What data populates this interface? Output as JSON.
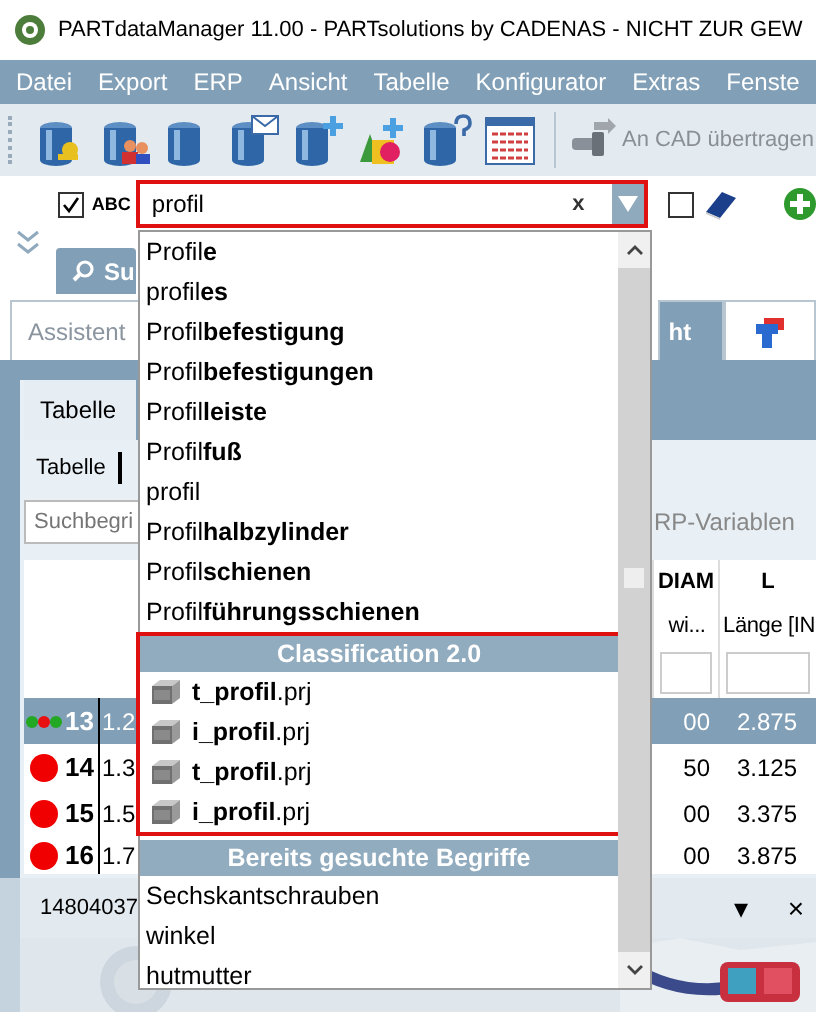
{
  "window": {
    "title": "PARTdataManager 11.00 - PARTsolutions by CADENAS - NICHT ZUR GEW"
  },
  "menu": [
    "Datei",
    "Export",
    "ERP",
    "Ansicht",
    "Tabelle",
    "Konfigurator",
    "Extras",
    "Fenste"
  ],
  "toolbar": {
    "cad_button": "An CAD übertragen"
  },
  "search": {
    "abc_checked": true,
    "abc_label": "ABC",
    "value": "profil",
    "clear": "x",
    "highlighted": true,
    "book_checked": false
  },
  "search_button": "Su",
  "tabs": [
    {
      "label": "Assistent",
      "selected": false
    },
    {
      "label": "ht",
      "selected": true
    },
    {
      "kind": "icon",
      "selected": false
    }
  ],
  "panel": {
    "title": "Tabelle",
    "subtabs": [
      {
        "label": "Tabelle",
        "selected": true
      }
    ],
    "search_placeholder": "Suchbegri",
    "erp_label": "RP-Variablen"
  },
  "table": {
    "columns": [
      {
        "name": "DIAM",
        "subtitle": "wi..."
      },
      {
        "name": "L",
        "subtitle": "Länge [IN"
      }
    ],
    "rows": [
      {
        "dots": [
          {
            "color": "#22a822"
          },
          {
            "color": "#e81010"
          },
          {
            "color": "#22a822"
          }
        ],
        "number": "13",
        "col_2": "1.2",
        "diam": "00",
        "l": "2.875",
        "selected": true
      },
      {
        "dots": [
          {
            "color": "#f00000"
          }
        ],
        "number": "14",
        "col_2": "1.3",
        "diam": "50",
        "l": "3.125",
        "selected": false
      },
      {
        "dots": [
          {
            "color": "#f00000"
          }
        ],
        "number": "15",
        "col_2": "1.5",
        "diam": "00",
        "l": "3.375",
        "selected": false
      },
      {
        "dots": [
          {
            "color": "#f00000"
          }
        ],
        "number": "16",
        "col_2": "1.7",
        "diam": "00",
        "l": "3.875",
        "selected": false
      }
    ]
  },
  "bottom_panel": {
    "title": "14804037",
    "menu": "▾",
    "close": "×"
  },
  "dropdown": {
    "suggestions": [
      "Profil**e**",
      "profil**es**",
      "Profil**befestigung**",
      "Profil**befestigungen**",
      "Profil**leiste**",
      "Profil**fuß**",
      "profil",
      "Profil**halbzylinder**",
      "Profil**schienen**",
      "Profil**führungsschienen**"
    ],
    "sections": [
      {
        "title": "Classification 2.0",
        "highlighted": true,
        "kind": "files",
        "items": [
          "**t_profil**.prj",
          "**i_profil**.prj",
          "**t_profil**.prj",
          "**i_profil**.prj"
        ]
      },
      {
        "title": "Bereits gesuchte Begriffe",
        "highlighted": false,
        "kind": "terms",
        "items": [
          "Sechskantschrauben",
          "winkel",
          "hutmutter"
        ]
      }
    ]
  }
}
